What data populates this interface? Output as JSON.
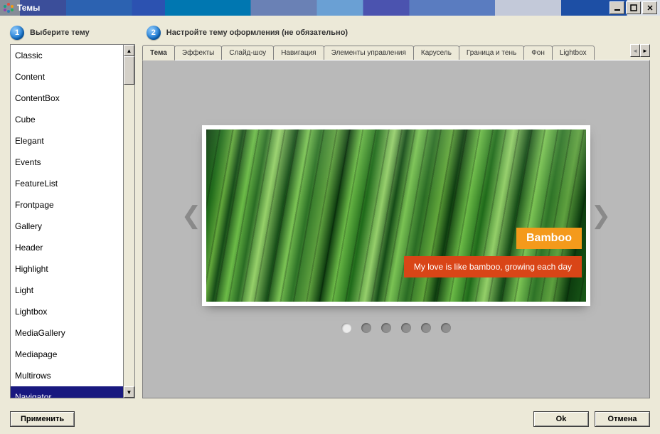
{
  "window": {
    "title": "Темы"
  },
  "steps": {
    "s1_num": "1",
    "s1_label": "Выберите тему",
    "s2_num": "2",
    "s2_label": "Настройте тему оформления (не обязательно)"
  },
  "themes": {
    "items": [
      "Classic",
      "Content",
      "ContentBox",
      "Cube",
      "Elegant",
      "Events",
      "FeatureList",
      "Frontpage",
      "Gallery",
      "Header",
      "Highlight",
      "Light",
      "Lightbox",
      "MediaGallery",
      "Mediapage",
      "Multirows",
      "Navigator"
    ],
    "selected_index": 16
  },
  "tabs": {
    "items": [
      "Тема",
      "Эффекты",
      "Слайд-шоу",
      "Навигация",
      "Элементы управления",
      "Карусель",
      "Граница и тень",
      "Фон",
      "Lightbox"
    ],
    "active_index": 0
  },
  "slide": {
    "title": "Bamboo",
    "caption": "My love is like bamboo, growing each day",
    "dot_count": 6,
    "active_dot": 0
  },
  "buttons": {
    "apply": "Применить",
    "ok": "Ok",
    "cancel": "Отмена"
  }
}
